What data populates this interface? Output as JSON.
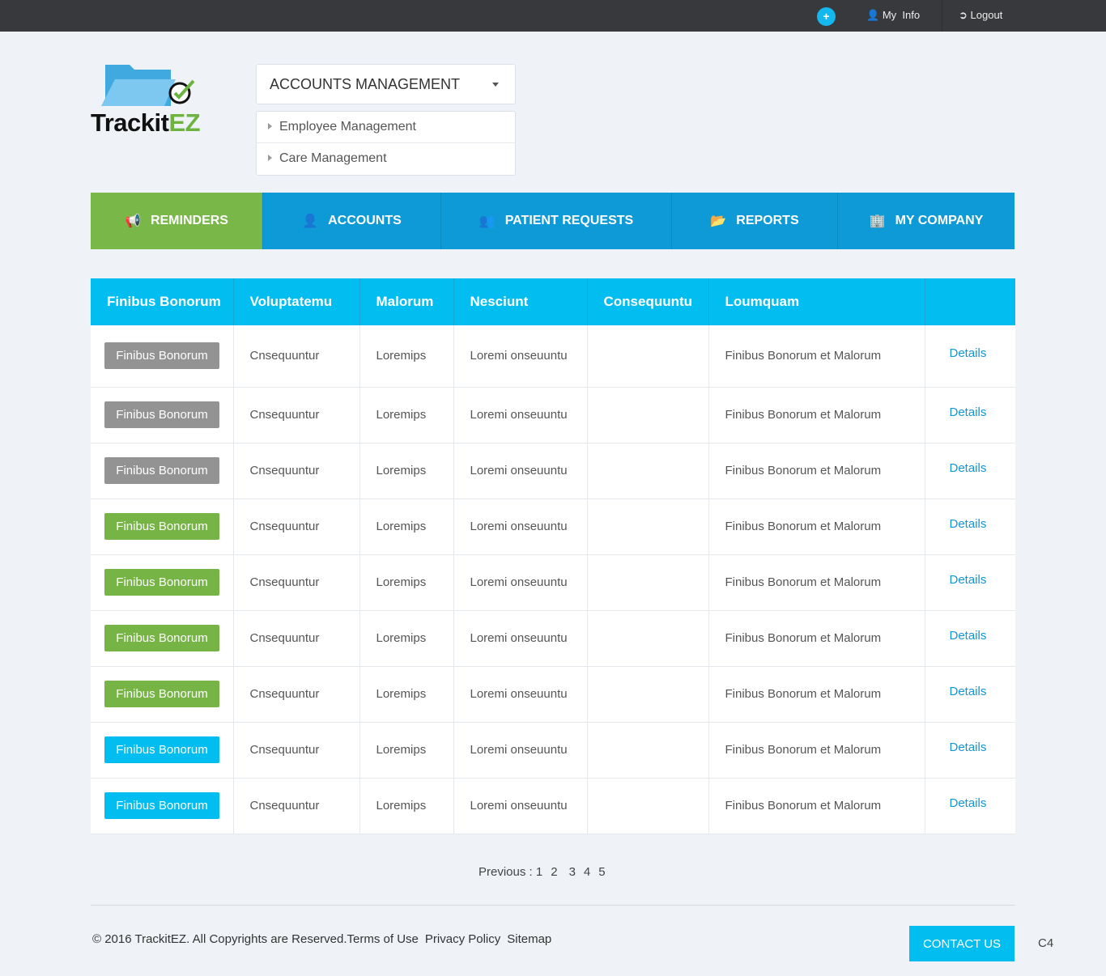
{
  "topbar": {
    "myinfo": "My  Info",
    "logout": "Logout"
  },
  "logo": {
    "text_a": "Trackit",
    "text_b": "EZ"
  },
  "menu": {
    "selected": "ACCOUNTS MANAGEMENT",
    "items": [
      "Employee Management",
      "Care Management"
    ]
  },
  "nav": [
    {
      "label": "REMINDERS",
      "icon": "megaphone-icon"
    },
    {
      "label": "ACCOUNTS",
      "icon": "user-icon"
    },
    {
      "label": "PATIENT REQUESTS",
      "icon": "users-icon"
    },
    {
      "label": "REPORTS",
      "icon": "folder-open-icon"
    },
    {
      "label": "MY COMPANY",
      "icon": "building-icon"
    }
  ],
  "table": {
    "headers": [
      "Finibus Bonorum",
      "Voluptatemu",
      "Malorum",
      "Nesciunt",
      "Consequuntu",
      "Loumquam",
      ""
    ],
    "rows": [
      {
        "badge": "Finibus Bonorum",
        "status": "gray",
        "c2": "Cnsequuntur",
        "c3": "Loremips",
        "c4": "Loremi onseuuntu",
        "c5": "",
        "c6": "Finibus Bonorum et Malorum",
        "link": "Details"
      },
      {
        "badge": "Finibus Bonorum",
        "status": "gray",
        "c2": "Cnsequuntur",
        "c3": "Loremips",
        "c4": "Loremi onseuuntu",
        "c5": "",
        "c6": "Finibus Bonorum et Malorum",
        "link": "Details"
      },
      {
        "badge": "Finibus Bonorum",
        "status": "gray",
        "c2": "Cnsequuntur",
        "c3": "Loremips",
        "c4": "Loremi onseuuntu",
        "c5": "",
        "c6": "Finibus Bonorum et Malorum",
        "link": "Details"
      },
      {
        "badge": "Finibus Bonorum",
        "status": "green",
        "c2": "Cnsequuntur",
        "c3": "Loremips",
        "c4": "Loremi onseuuntu",
        "c5": "",
        "c6": "Finibus Bonorum et Malorum",
        "link": "Details"
      },
      {
        "badge": "Finibus Bonorum",
        "status": "green",
        "c2": "Cnsequuntur",
        "c3": "Loremips",
        "c4": "Loremi onseuuntu",
        "c5": "",
        "c6": "Finibus Bonorum et Malorum",
        "link": "Details"
      },
      {
        "badge": "Finibus Bonorum",
        "status": "green",
        "c2": "Cnsequuntur",
        "c3": "Loremips",
        "c4": "Loremi onseuuntu",
        "c5": "",
        "c6": "Finibus Bonorum et Malorum",
        "link": "Details"
      },
      {
        "badge": "Finibus Bonorum",
        "status": "green",
        "c2": "Cnsequuntur",
        "c3": "Loremips",
        "c4": "Loremi onseuuntu",
        "c5": "",
        "c6": "Finibus Bonorum et Malorum",
        "link": "Details"
      },
      {
        "badge": "Finibus Bonorum",
        "status": "blue",
        "c2": "Cnsequuntur",
        "c3": "Loremips",
        "c4": "Loremi onseuuntu",
        "c5": "",
        "c6": "Finibus Bonorum et Malorum",
        "link": "Details"
      },
      {
        "badge": "Finibus Bonorum",
        "status": "blue",
        "c2": "Cnsequuntur",
        "c3": "Loremips",
        "c4": "Loremi onseuuntu",
        "c5": "",
        "c6": "Finibus Bonorum et Malorum",
        "link": "Details"
      }
    ]
  },
  "status_colors": {
    "gray": "#939393",
    "green": "#76b446",
    "blue": "#02bdf0"
  },
  "pager": {
    "label": "Previous : ",
    "pages": [
      "1",
      "2",
      "3",
      "4",
      "5"
    ]
  },
  "footer": {
    "copyright": "© 2016 TrackitEZ. All Copyrights are Reserved.",
    "links": [
      "Terms of Use",
      "Privacy Policy",
      "Sitemap"
    ],
    "contact": "CONTACT US",
    "code": "C4"
  }
}
